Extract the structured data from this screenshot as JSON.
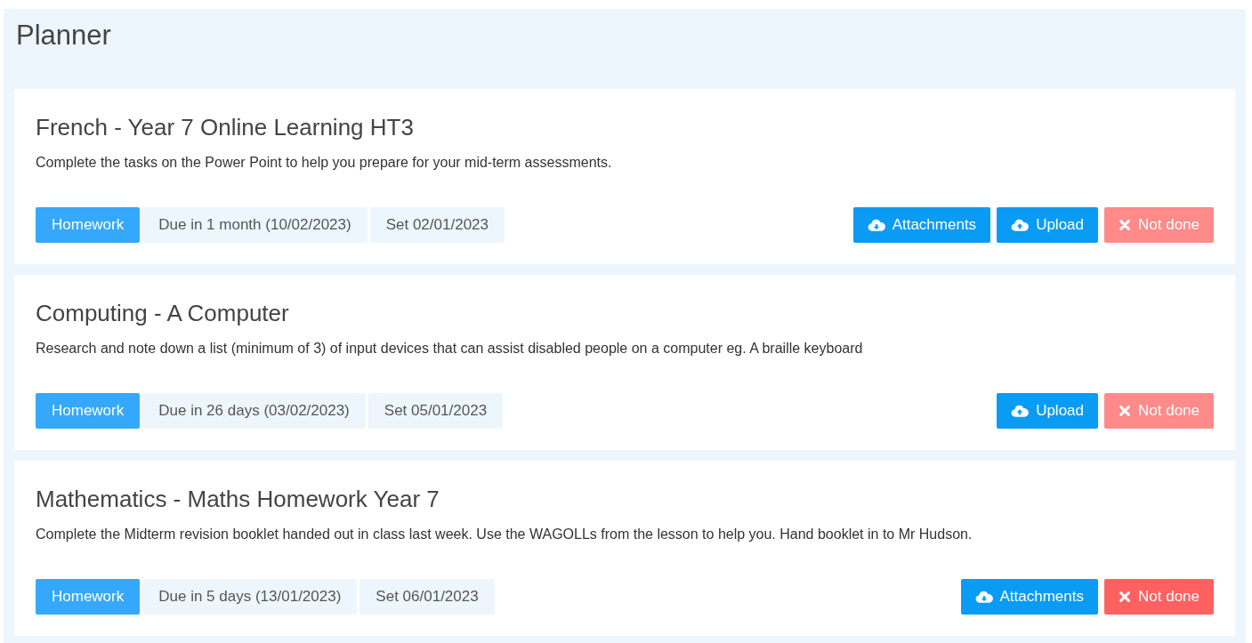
{
  "title": "Planner",
  "tasks": [
    {
      "title": "French - Year 7 Online Learning HT3",
      "description": "Complete the tasks on the Power Point to help you prepare for your mid-term assessments.",
      "type": "Homework",
      "due": "Due in 1 month (10/02/2023)",
      "set": "Set 02/01/2023",
      "buttons": [
        {
          "kind": "attachments",
          "label": "Attachments"
        },
        {
          "kind": "upload",
          "label": "Upload"
        },
        {
          "kind": "not_done",
          "label": "Not done",
          "disabled": true
        }
      ]
    },
    {
      "title": "Computing - A Computer",
      "description": "Research and note down a list (minimum of 3) of input devices that can assist disabled people on a computer eg. A braille keyboard",
      "type": "Homework",
      "due": "Due in 26 days (03/02/2023)",
      "set": "Set 05/01/2023",
      "buttons": [
        {
          "kind": "upload",
          "label": "Upload"
        },
        {
          "kind": "not_done",
          "label": "Not done",
          "disabled": true
        }
      ]
    },
    {
      "title": "Mathematics - Maths Homework Year 7",
      "description": "Complete the Midterm revision booklet handed out in class last week. Use the WAGOLLs from the lesson to help you. Hand booklet in to Mr Hudson.",
      "type": "Homework",
      "due": "Due in 5 days (13/01/2023)",
      "set": "Set 06/01/2023",
      "buttons": [
        {
          "kind": "attachments",
          "label": "Attachments"
        },
        {
          "kind": "not_done",
          "label": "Not done",
          "disabled": false
        }
      ]
    }
  ]
}
